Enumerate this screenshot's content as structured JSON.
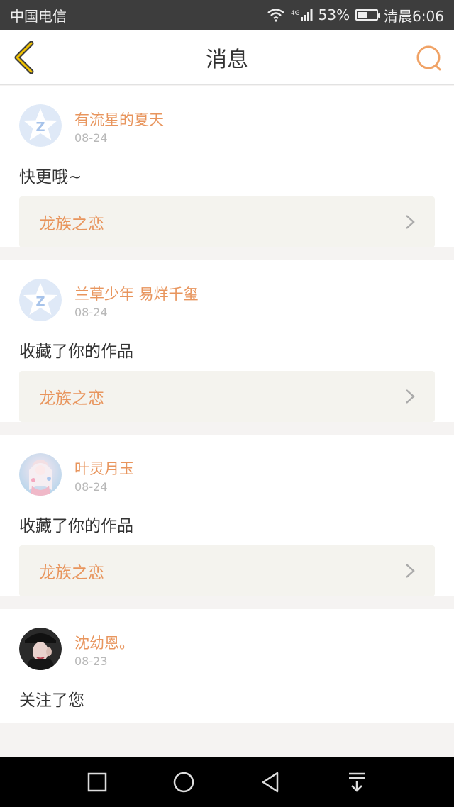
{
  "status_bar": {
    "carrier": "中国电信",
    "network": "4G",
    "battery": "53%",
    "battery_level": 0.53,
    "time": "清晨6:06"
  },
  "header": {
    "title": "消息",
    "back_icon": "chevron-left-icon",
    "search_icon": "search-icon"
  },
  "messages": [
    {
      "sender": "有流星的夏天",
      "date": "08-24",
      "text": "快更哦~",
      "work": "龙族之恋",
      "avatar": "default-star-avatar"
    },
    {
      "sender": "兰草少年 易烊千玺",
      "date": "08-24",
      "text": "收藏了你的作品",
      "work": "龙族之恋",
      "avatar": "default-star-avatar"
    },
    {
      "sender": "叶灵月玉",
      "date": "08-24",
      "text": "收藏了你的作品",
      "work": "龙族之恋",
      "avatar": "anime-girl-avatar"
    },
    {
      "sender": "沈幼恩。",
      "date": "08-23",
      "text": "关注了您",
      "avatar": "photo-avatar"
    }
  ],
  "colors": {
    "accent": "#e8955d",
    "accent_icon": "#f0a265",
    "status_bar_bg": "#3d3d3d",
    "card_link_bg": "#f4f3ee"
  },
  "nav": {
    "square_icon": "recent-apps-icon",
    "circle_icon": "home-icon",
    "triangle_icon": "back-icon",
    "down_icon": "notification-pulldown-icon"
  }
}
